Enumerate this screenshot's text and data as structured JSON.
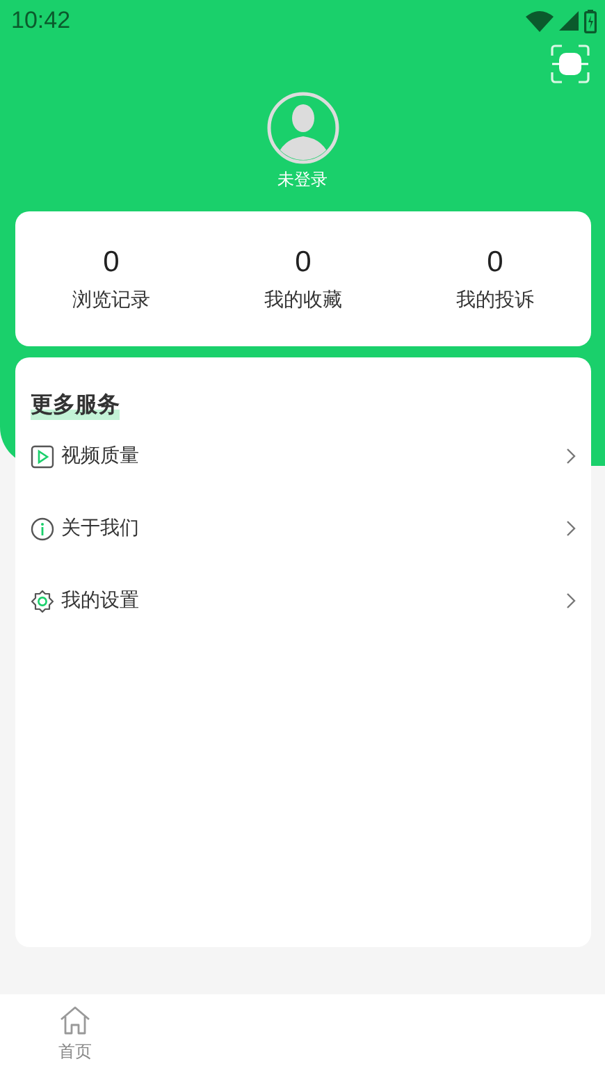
{
  "status_bar": {
    "time": "10:42"
  },
  "profile": {
    "name": "未登录"
  },
  "stats": [
    {
      "value": "0",
      "label": "浏览记录"
    },
    {
      "value": "0",
      "label": "我的收藏"
    },
    {
      "value": "0",
      "label": "我的投诉"
    }
  ],
  "services": {
    "title": "更多服务",
    "items": [
      {
        "kind": "video",
        "label": "视频质量"
      },
      {
        "kind": "info",
        "label": "关于我们"
      },
      {
        "kind": "settings",
        "label": "我的设置"
      }
    ]
  },
  "bottom_nav": [
    {
      "kind": "home",
      "label": "首页"
    }
  ]
}
